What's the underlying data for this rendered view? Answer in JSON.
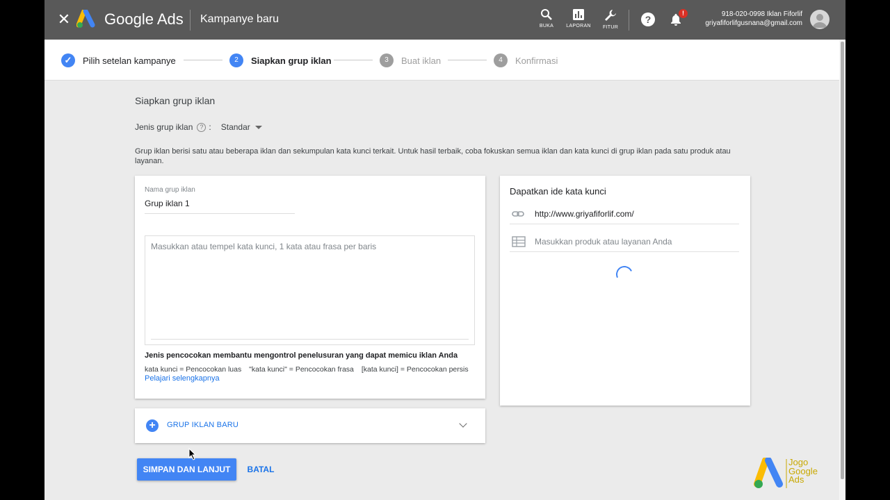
{
  "topbar": {
    "close_glyph": "✕",
    "brand": "Google Ads",
    "campaign_title": "Kampanye baru",
    "tools": [
      {
        "label": "BUKA",
        "icon": "search-icon"
      },
      {
        "label": "LAPORAN",
        "icon": "bar-chart-icon"
      },
      {
        "label": "FITUR",
        "icon": "wrench-icon"
      }
    ],
    "help_glyph": "?",
    "notification_badge": "!",
    "account_id": "918-020-0998 Iklan Fiforlif",
    "account_email": "griyafiforlifgusnana@gmail.com"
  },
  "stepper": {
    "steps": [
      {
        "number": "✓",
        "label": "Pilih setelan kampanye",
        "state": "done"
      },
      {
        "number": "2",
        "label": "Siapkan grup iklan",
        "state": "active"
      },
      {
        "number": "3",
        "label": "Buat iklan",
        "state": "inactive"
      },
      {
        "number": "4",
        "label": "Konfirmasi",
        "state": "inactive"
      }
    ]
  },
  "section": {
    "title": "Siapkan grup iklan",
    "type_label": "Jenis grup iklan",
    "type_colon": ":",
    "type_value": "Standar",
    "description": "Grup iklan berisi satu atau beberapa iklan dan sekumpulan kata kunci terkait. Untuk hasil terbaik, coba fokuskan semua iklan dan kata kunci di grup iklan pada satu produk atau layanan."
  },
  "ad_group": {
    "name_label": "Nama grup iklan",
    "name_value": "Grup iklan 1",
    "keywords_placeholder": "Masukkan atau tempel kata kunci, 1 kata atau frasa per baris",
    "match_title": "Jenis pencocokan membantu mengontrol penelusuran yang dapat memicu iklan Anda",
    "match_broad": "kata kunci = Pencocokan luas",
    "match_phrase": "\"kata kunci\" = Pencocokan frasa",
    "match_exact": "[kata kunci] = Pencocokan persis",
    "learn_more": "Pelajari selengkapnya"
  },
  "keyword_ideas": {
    "title": "Dapatkan ide kata kunci",
    "url_value": "http://www.griyafiforlif.com/",
    "product_placeholder": "Masukkan produk atau layanan Anda"
  },
  "new_group": {
    "label": "GRUP IKLAN BARU"
  },
  "actions": {
    "save": "SIMPAN DAN LANJUT",
    "cancel": "BATAL"
  },
  "watermark": {
    "line1": "Jogo",
    "line2": "Google",
    "line3": "Ads"
  },
  "colors": {
    "accent": "#4285f4",
    "link": "#1a73e8",
    "topbar": "#595959",
    "inactive_step": "#9e9e9e"
  }
}
